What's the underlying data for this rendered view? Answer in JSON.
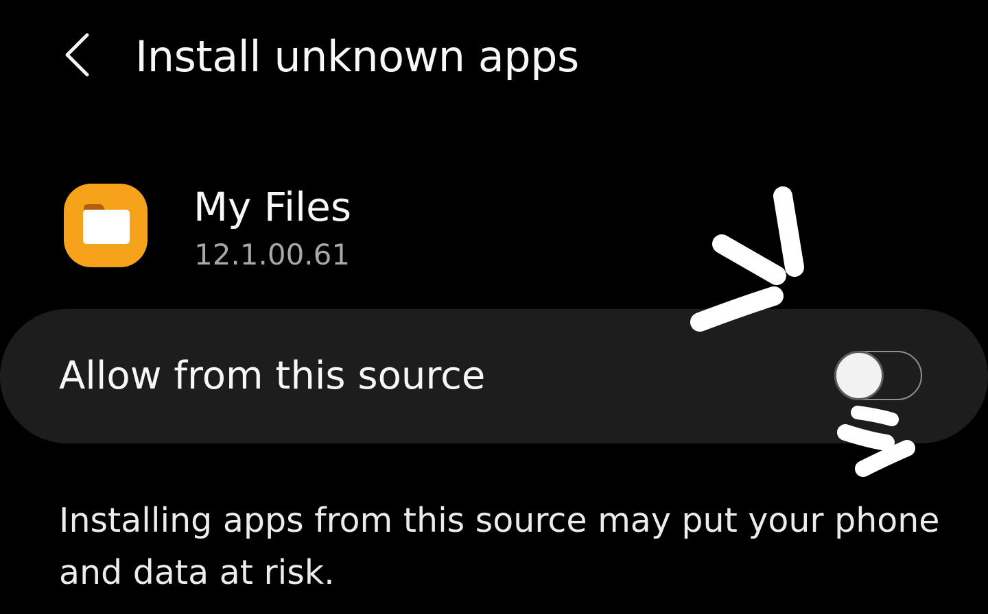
{
  "header": {
    "back_icon": "chevron-left-icon",
    "title": "Install unknown apps"
  },
  "app": {
    "icon": "folder-icon",
    "icon_color": "#f7a21b",
    "name": "My Files",
    "version": "12.1.00.61"
  },
  "setting": {
    "label": "Allow from this source",
    "enabled": false
  },
  "warning": {
    "text": "Installing apps from this source may put your phone and data at risk."
  },
  "annotation": {
    "icon": "hand-drawn-emphasis-marks",
    "color": "#ffffff"
  }
}
